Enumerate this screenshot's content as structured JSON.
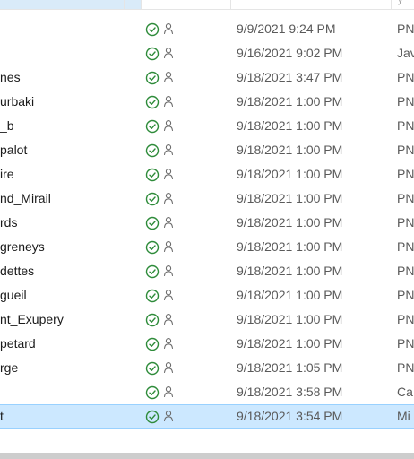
{
  "colors": {
    "selected_row": "#cce8ff",
    "status_green": "#2e8b3a",
    "scrollbar": "#cdcdcd"
  },
  "header": {
    "type_stub": "y"
  },
  "rows": [
    {
      "name": "",
      "status_icons": [
        "check-circle-icon",
        "person-icon"
      ],
      "date": "9/9/2021 9:24 PM",
      "type": "PN"
    },
    {
      "name": "",
      "status_icons": [
        "check-circle-icon",
        "person-icon"
      ],
      "date": "9/16/2021 9:02 PM",
      "type": "Jav"
    },
    {
      "name": "nes",
      "status_icons": [
        "check-circle-icon",
        "person-icon"
      ],
      "date": "9/18/2021 3:47 PM",
      "type": "PN"
    },
    {
      "name": "urbaki",
      "status_icons": [
        "check-circle-icon",
        "person-icon"
      ],
      "date": "9/18/2021 1:00 PM",
      "type": "PN"
    },
    {
      "name": "_b",
      "status_icons": [
        "check-circle-icon",
        "person-icon"
      ],
      "date": "9/18/2021 1:00 PM",
      "type": "PN"
    },
    {
      "name": "palot",
      "status_icons": [
        "check-circle-icon",
        "person-icon"
      ],
      "date": "9/18/2021 1:00 PM",
      "type": "PN"
    },
    {
      "name": "ire",
      "status_icons": [
        "check-circle-icon",
        "person-icon"
      ],
      "date": "9/18/2021 1:00 PM",
      "type": "PN"
    },
    {
      "name": "nd_Mirail",
      "status_icons": [
        "check-circle-icon",
        "person-icon"
      ],
      "date": "9/18/2021 1:00 PM",
      "type": "PN"
    },
    {
      "name": "rds",
      "status_icons": [
        "check-circle-icon",
        "person-icon"
      ],
      "date": "9/18/2021 1:00 PM",
      "type": "PN"
    },
    {
      "name": "greneys",
      "status_icons": [
        "check-circle-icon",
        "person-icon"
      ],
      "date": "9/18/2021 1:00 PM",
      "type": "PN"
    },
    {
      "name": "dettes",
      "status_icons": [
        "check-circle-icon",
        "person-icon"
      ],
      "date": "9/18/2021 1:00 PM",
      "type": "PN"
    },
    {
      "name": "gueil",
      "status_icons": [
        "check-circle-icon",
        "person-icon"
      ],
      "date": "9/18/2021 1:00 PM",
      "type": "PN"
    },
    {
      "name": "nt_Exupery",
      "status_icons": [
        "check-circle-icon",
        "person-icon"
      ],
      "date": "9/18/2021 1:00 PM",
      "type": "PN"
    },
    {
      "name": "petard",
      "status_icons": [
        "check-circle-icon",
        "person-icon"
      ],
      "date": "9/18/2021 1:00 PM",
      "type": "PN"
    },
    {
      "name": "rge",
      "status_icons": [
        "check-circle-icon",
        "person-icon"
      ],
      "date": "9/18/2021 1:05 PM",
      "type": "PN"
    },
    {
      "name": "",
      "status_icons": [
        "check-circle-icon",
        "person-icon"
      ],
      "date": "9/18/2021 3:58 PM",
      "type": "Ca"
    },
    {
      "name": "t",
      "status_icons": [
        "check-circle-icon",
        "person-icon"
      ],
      "date": "9/18/2021 3:54 PM",
      "type": "Mi",
      "selected": true
    }
  ]
}
